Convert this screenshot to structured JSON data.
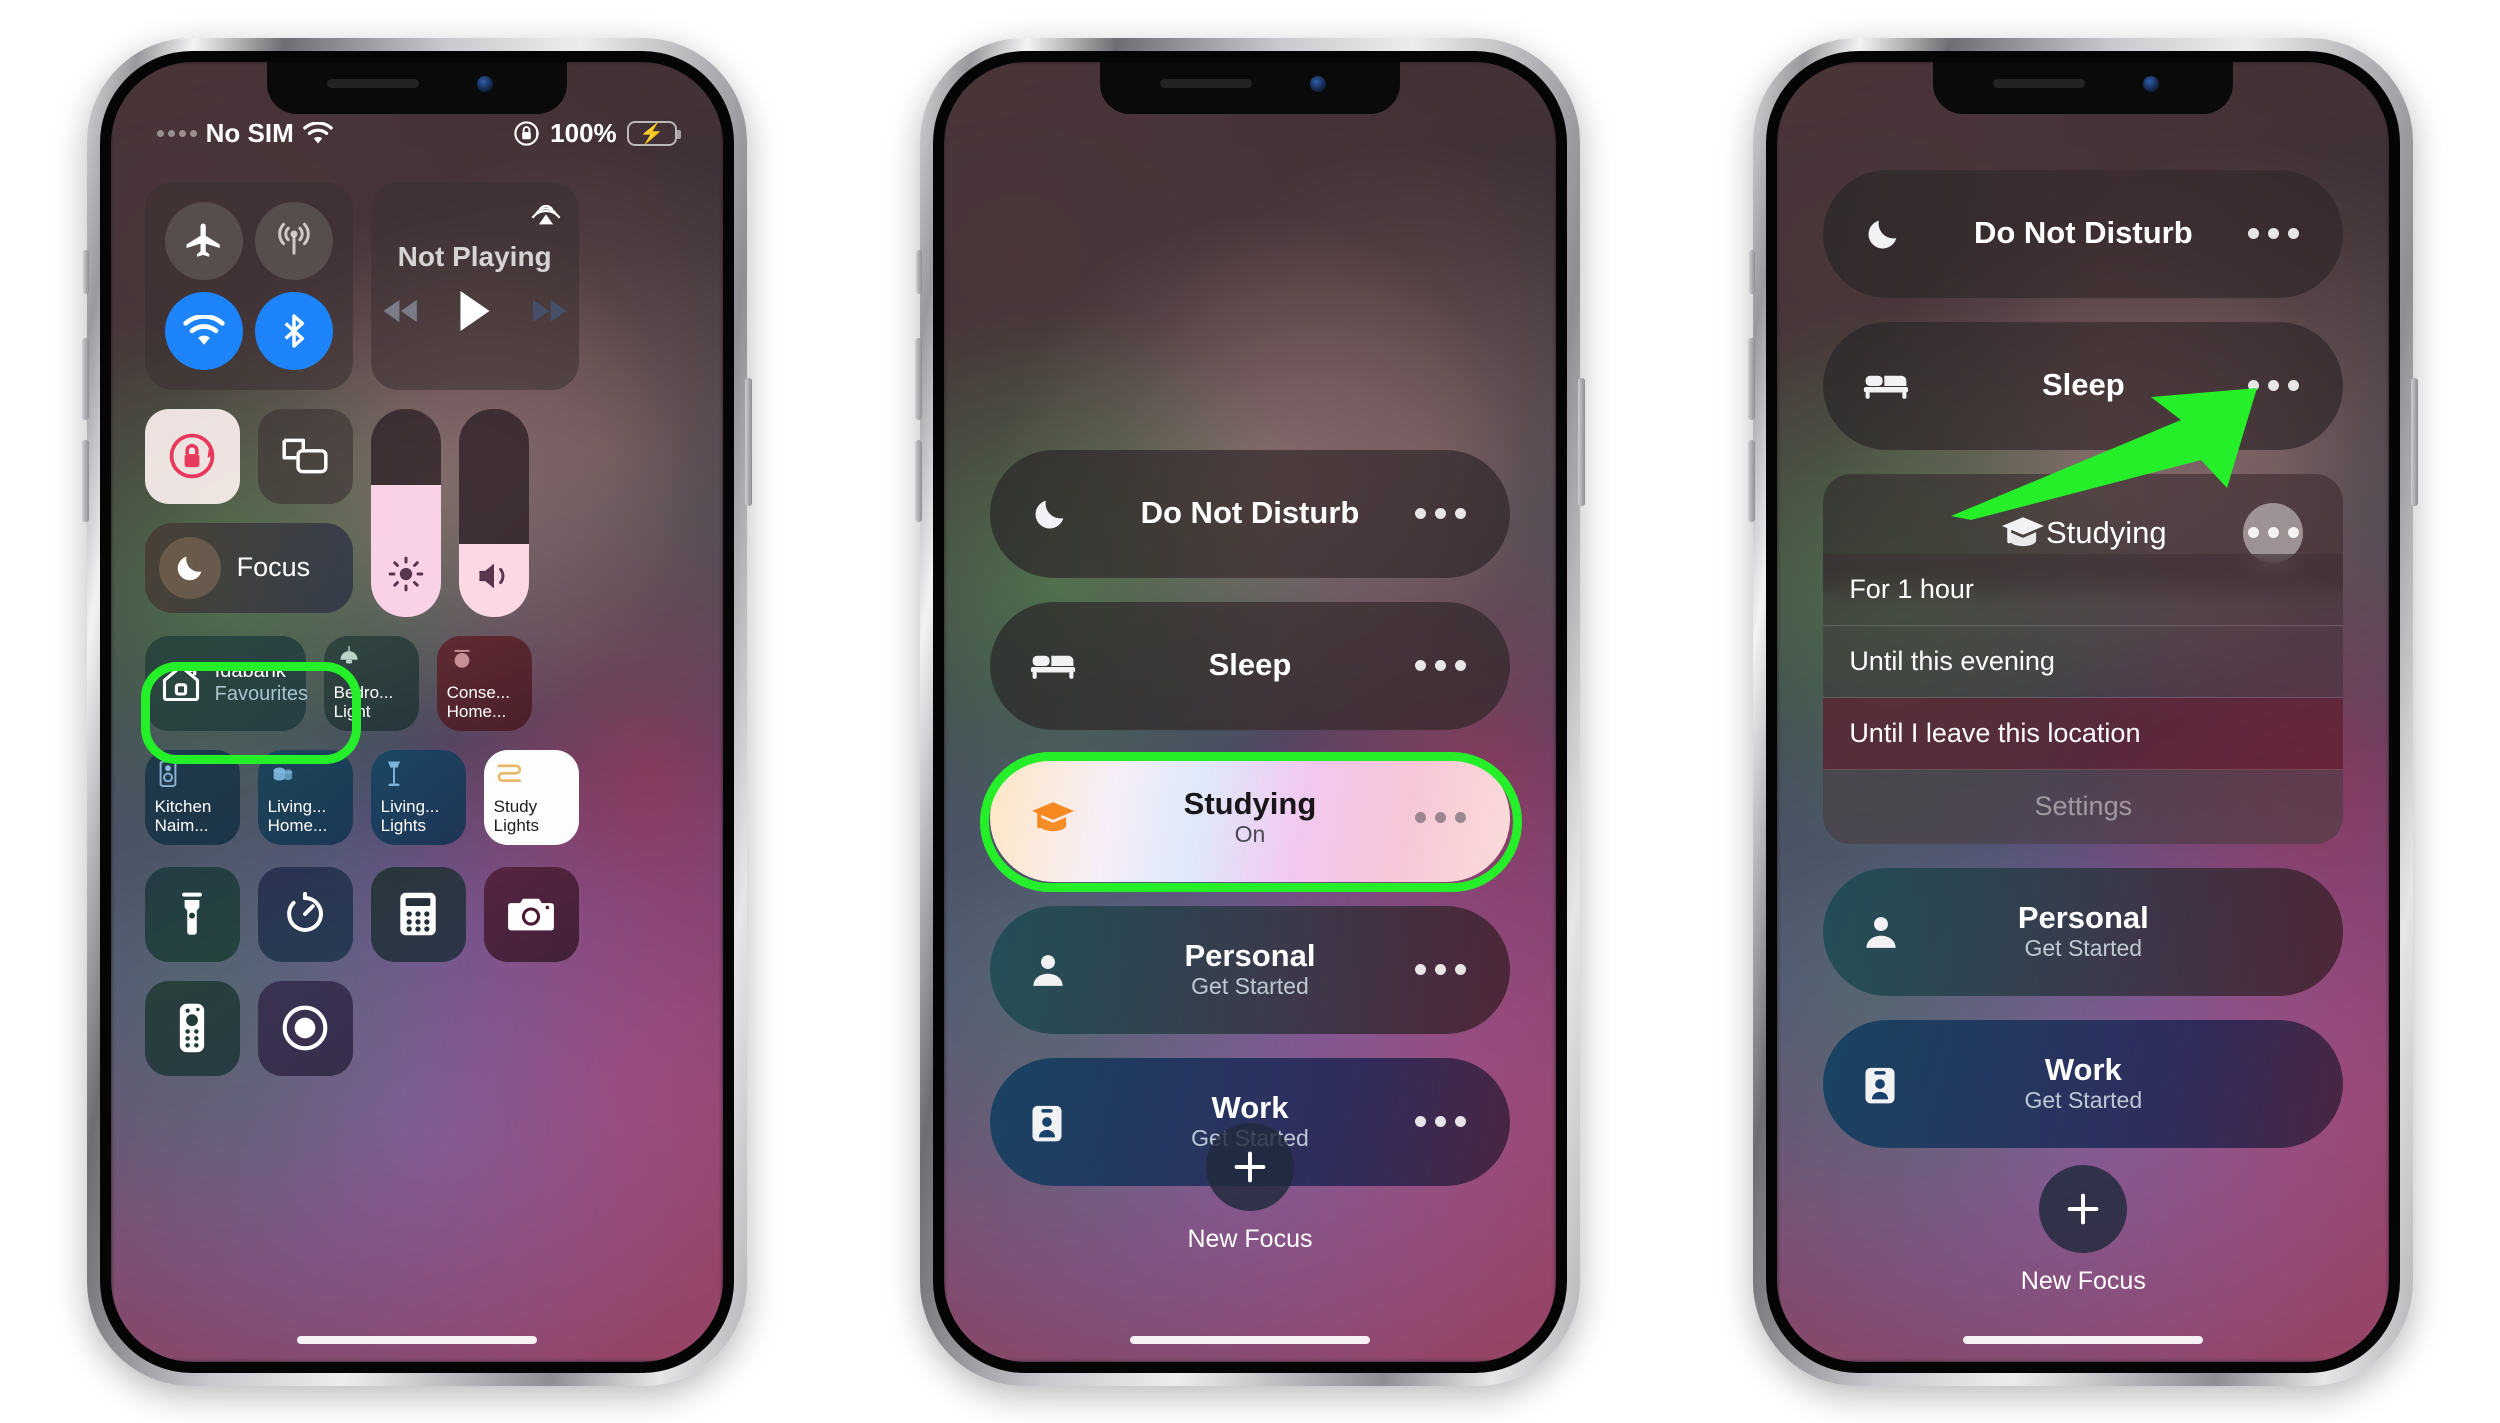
{
  "status_bar": {
    "carrier": "No SIM",
    "wifi_icon": "wifi-icon",
    "battery_percent": "100%",
    "orientation_lock_icon": "rotation-lock-icon",
    "battery_icon": "battery-charging-icon"
  },
  "phone1": {
    "connectivity": {
      "airplane": {
        "icon": "airplane-icon",
        "state": "off"
      },
      "cellular": {
        "icon": "cellular-antenna-icon",
        "state": "off"
      },
      "wifi": {
        "icon": "wifi-icon",
        "state": "on"
      },
      "bluetooth": {
        "icon": "bluetooth-icon",
        "state": "on"
      }
    },
    "media": {
      "title": "Not Playing",
      "airplay_icon": "airplay-icon",
      "prev_icon": "rewind-icon",
      "play_icon": "play-icon",
      "next_icon": "fast-forward-icon"
    },
    "rotation_lock": {
      "icon": "rotation-lock-icon",
      "state": "on"
    },
    "screen_mirroring": {
      "icon": "screen-mirroring-icon"
    },
    "focus": {
      "label": "Focus",
      "icon": "moon-icon",
      "highlighted": true
    },
    "brightness": {
      "icon": "brightness-icon",
      "level": 63
    },
    "volume": {
      "icon": "volume-icon",
      "level": 35
    },
    "home": {
      "main": {
        "title": "Idabank",
        "subtitle": "Favourites",
        "icon": "house-icon"
      },
      "accessories_row1": [
        {
          "line1": "Bedro...",
          "line2": "Light",
          "icon": "pendant-lamp-icon"
        },
        {
          "line1": "Conse...",
          "line2": "Home...",
          "icon": "ceiling-light-icon"
        }
      ],
      "accessories_row2": [
        {
          "line1": "Kitchen",
          "line2": "Naim...",
          "icon": "speaker-icon",
          "state": "off"
        },
        {
          "line1": "Living...",
          "line2": "Home...",
          "icon": "speakers-icon",
          "state": "off"
        },
        {
          "line1": "Living...",
          "line2": "Lights",
          "icon": "floor-lamp-icon",
          "state": "off"
        },
        {
          "line1": "Study",
          "line2": "Lights",
          "icon": "light-strip-icon",
          "state": "on"
        }
      ]
    },
    "utilities_row1": [
      {
        "icon": "flashlight-icon"
      },
      {
        "icon": "timer-icon"
      },
      {
        "icon": "calculator-icon"
      },
      {
        "icon": "camera-icon"
      }
    ],
    "utilities_row2": [
      {
        "icon": "apple-tv-remote-icon"
      },
      {
        "icon": "screen-record-icon"
      }
    ]
  },
  "phone2": {
    "focus_modes": [
      {
        "name": "Do Not Disturb",
        "icon": "moon-icon",
        "status": "",
        "style": "dark",
        "highlighted": false
      },
      {
        "name": "Sleep",
        "icon": "bed-icon",
        "status": "",
        "style": "dark",
        "highlighted": false
      },
      {
        "name": "Studying",
        "icon": "graduation-cap-icon",
        "status": "On",
        "style": "studying",
        "highlighted": true
      },
      {
        "name": "Personal",
        "icon": "person-icon",
        "status": "Get Started",
        "style": "teal",
        "highlighted": false
      },
      {
        "name": "Work",
        "icon": "id-badge-icon",
        "status": "Get Started",
        "style": "navy",
        "highlighted": false
      }
    ],
    "new_focus": {
      "label": "New Focus",
      "icon": "plus-icon"
    }
  },
  "phone3": {
    "focus_modes_top": [
      {
        "name": "Do Not Disturb",
        "icon": "moon-icon",
        "style": "dark"
      },
      {
        "name": "Sleep",
        "icon": "bed-icon",
        "style": "dark"
      }
    ],
    "expanded": {
      "name": "Studying",
      "icon": "graduation-cap-icon",
      "more_icon": "ellipsis-icon",
      "options": [
        {
          "label": "For 1 hour",
          "selected": false
        },
        {
          "label": "Until this evening",
          "selected": false
        },
        {
          "label": "Until I leave this location",
          "selected": true
        }
      ],
      "settings_label": "Settings"
    },
    "focus_modes_bottom": [
      {
        "name": "Personal",
        "icon": "person-icon",
        "status": "Get Started",
        "style": "teal"
      },
      {
        "name": "Work",
        "icon": "id-badge-icon",
        "status": "Get Started",
        "style": "navy"
      }
    ],
    "new_focus": {
      "label": "New Focus",
      "icon": "plus-icon"
    }
  },
  "annotations": {
    "highlight_color": "#25ef29",
    "arrow_color": "#25ef29",
    "arrow_target": "studying-more-button"
  }
}
